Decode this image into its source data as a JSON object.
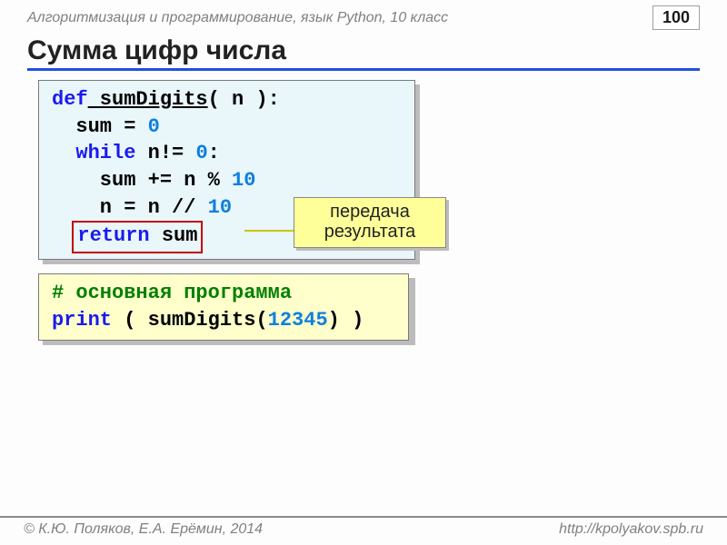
{
  "header": {
    "chapter": "Алгоритмизация и программирование, язык Python, 10 класс",
    "page": "100"
  },
  "title": "Сумма цифр числа",
  "code1": {
    "l1_def": "def",
    "l1_fn": " sumDigits",
    "l1_rest": "( n ):",
    "l2_a": "  sum = ",
    "l2_n": "0",
    "l3_kw": "  while",
    "l3_mid": " n!= ",
    "l3_n": "0",
    "l3_end": ":",
    "l4_a": "    sum += n % ",
    "l4_n": "10",
    "l5_a": "    n = n // ",
    "l5_n": "10",
    "l6_kw": "return",
    "l6_rest": " sum"
  },
  "callout": "передача результата",
  "code2": {
    "c_cmt": "# основная программа",
    "c_print": "print",
    "c_a": " ( sumDigits(",
    "c_n": "12345",
    "c_b": ") )"
  },
  "footer": {
    "left": "© К.Ю. Поляков, Е.А. Ерёмин, 2014",
    "right": "http://kpolyakov.spb.ru"
  }
}
